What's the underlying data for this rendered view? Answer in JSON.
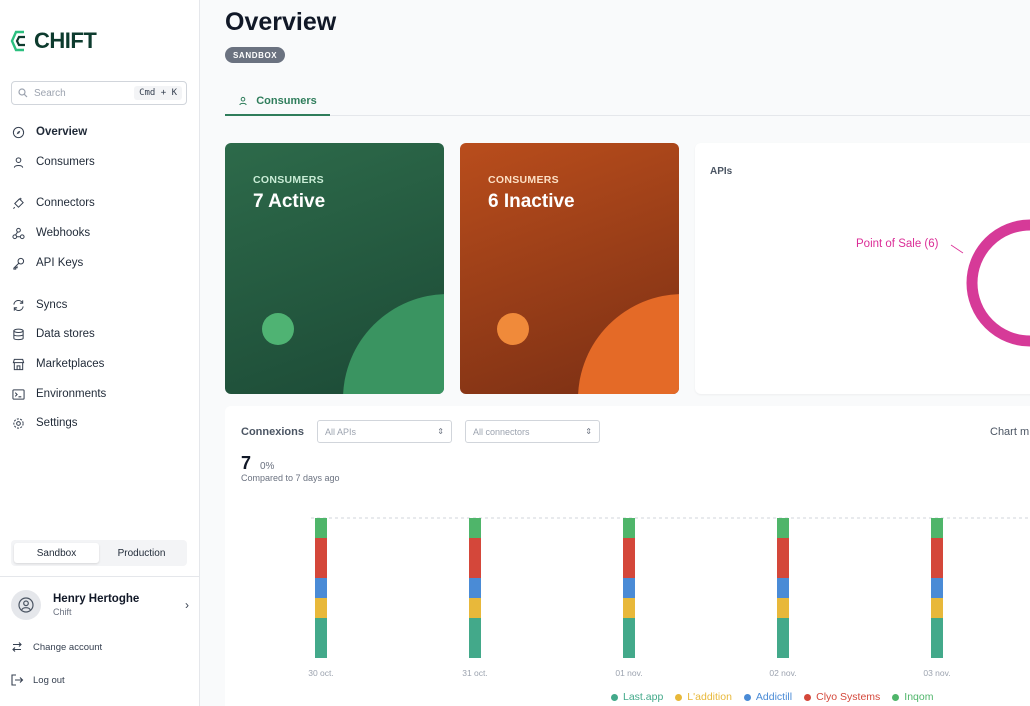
{
  "brand": {
    "name": "CHIFT"
  },
  "search": {
    "placeholder": "Search",
    "shortcut": "Cmd + K"
  },
  "sidebar": {
    "items": [
      {
        "label": "Overview",
        "icon": "compass-icon",
        "active": true
      },
      {
        "label": "Consumers",
        "icon": "user-icon"
      },
      {
        "label": "Connectors",
        "icon": "plug-icon"
      },
      {
        "label": "Webhooks",
        "icon": "webhook-icon"
      },
      {
        "label": "API Keys",
        "icon": "key-icon"
      },
      {
        "label": "Syncs",
        "icon": "sync-icon"
      },
      {
        "label": "Data stores",
        "icon": "database-icon"
      },
      {
        "label": "Marketplaces",
        "icon": "store-icon"
      },
      {
        "label": "Environments",
        "icon": "terminal-icon"
      },
      {
        "label": "Settings",
        "icon": "gear-icon"
      }
    ],
    "env_switch": {
      "options": [
        "Sandbox",
        "Production"
      ],
      "selected": "Sandbox"
    },
    "user": {
      "name": "Henry Hertoghe",
      "org": "Chift"
    },
    "change_account": "Change account",
    "logout": "Log out"
  },
  "page": {
    "title": "Overview",
    "badge": "SANDBOX"
  },
  "tabs": [
    {
      "label": "Consumers",
      "icon": "user-icon",
      "active": true
    }
  ],
  "stats": {
    "active": {
      "label": "CONSUMERS",
      "value": "7 Active",
      "color": "#2d6a4a"
    },
    "inactive": {
      "label": "CONSUMERS",
      "value": "6 Inactive",
      "color": "#b94d1c"
    }
  },
  "apis": {
    "title": "APIs",
    "slice_label": "Point of Sale (6)",
    "slice_color": "#db2e97"
  },
  "connexions": {
    "title": "Connexions",
    "filters": [
      {
        "placeholder": "All APIs"
      },
      {
        "placeholder": "All connectors"
      }
    ],
    "chart_mode_label": "Chart m",
    "total": "7",
    "change": "0%",
    "compare": "Compared to 7 days ago"
  },
  "chart_data": {
    "type": "bar",
    "stacked": true,
    "categories": [
      "30 oct.",
      "31 oct.",
      "01 nov.",
      "02 nov.",
      "03 nov."
    ],
    "series": [
      {
        "name": "Last.app",
        "color": "#43a98a",
        "values": [
          2,
          2,
          2,
          2,
          2
        ]
      },
      {
        "name": "L'addition",
        "color": "#e8b83a",
        "values": [
          1,
          1,
          1,
          1,
          1
        ]
      },
      {
        "name": "Addictill",
        "color": "#4a8bd6",
        "values": [
          1,
          1,
          1,
          1,
          1
        ]
      },
      {
        "name": "Clyo Systems",
        "color": "#d4473a",
        "values": [
          2,
          2,
          2,
          2,
          2
        ]
      },
      {
        "name": "Inqom",
        "color": "#4fb56a",
        "values": [
          1,
          1,
          1,
          1,
          1
        ]
      }
    ],
    "ylim": [
      0,
      7
    ],
    "reference_line": 7,
    "grid": false,
    "legend_position": "bottom"
  }
}
